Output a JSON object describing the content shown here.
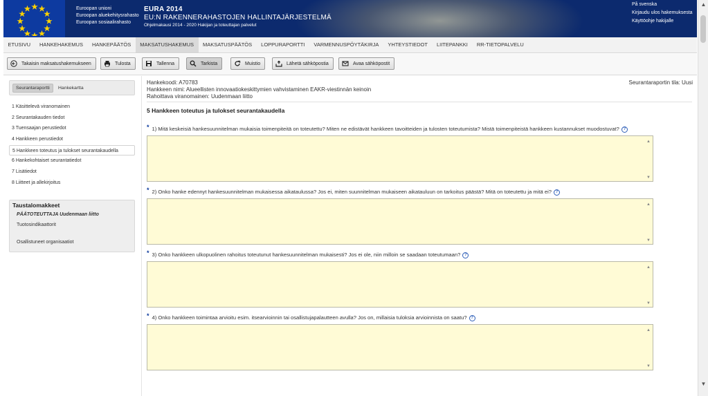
{
  "header": {
    "eu_lines": [
      "Euroopan unioni",
      "Euroopan aluekehitysrahasto",
      "Euroopan sosiaalirahasto"
    ],
    "title": "EURA 2014",
    "subtitle": "EU:N RAKENNERAHASTOJEN HALLINTAJÄRJESTELMÄ",
    "tagline": "Ohjelmakausi 2014 - 2020 Hakijan ja toteuttajan palvelut",
    "links": [
      "På svenska",
      "Kirjaudu ulos hakemuksesta",
      "Käyttöohje hakijalle"
    ]
  },
  "nav": {
    "items": [
      "ETUSIVU",
      "HANKEHAKEMUS",
      "HANKEPÄÄTÖS",
      "MAKSATUSHAKEMUS",
      "MAKSATUSPÄÄTÖS",
      "LOPPURAPORTTI",
      "VARMENNUSPÖYTÄKIRJA",
      "YHTEYSTIEDOT",
      "LIITEPANKKI",
      "RR-TIETOPALVELU"
    ],
    "active_index": 3
  },
  "toolbar": {
    "back": "Takaisin maksatushakemukseen",
    "print": "Tulosta",
    "save": "Tallenna",
    "check": "Tarkista",
    "memo": "Muistio",
    "send": "Lähetä sähköpostia",
    "open_mail": "Avaa sähköpostit"
  },
  "sidebar": {
    "tabs": [
      "Seurantaraportti",
      "Hankekartta"
    ],
    "items": [
      "1 Käsittelevä viranomainen",
      "2 Seurantakauden tiedot",
      "3 Tuensaajan perustiedot",
      "4 Hankkeen perustiedot",
      "5 Hankkeen toteutus ja tulokset seurantakaudella",
      "6 Hankekohtaiset seurantatiedot",
      "7 Lisätiedot",
      "8 Liitteet ja allekirjoitus"
    ],
    "active_index": 4,
    "background": {
      "title": "Taustalomakkeet",
      "items": [
        "PÄÄTOTEUTTAJA Uudenmaan liitto",
        "Tuotosindikaattorit",
        "Osallistuneet organisaatiot"
      ]
    }
  },
  "content": {
    "project_code": "Hankekoodi: A70783",
    "project_name": "Hankkeen nimi: Alueellisten innovaatiokeskittymien vahvistaminen EAKR-viestinnän keinoin",
    "authority": "Rahoittava viranomainen: Uudenmaan liitto",
    "report_status": "Seurantaraportin tila: Uusi",
    "section_title": "5 Hankkeen toteutus ja tulokset seurantakaudella",
    "required_mark": "*",
    "help_glyph": "?",
    "questions": [
      {
        "text": "1) Mitä keskeisiä hankesuunnitelman mukaisia toimenpiteitä on toteutettu? Miten ne edistävät hankkeen tavoitteiden ja tulosten toteutumista? Mistä toimenpiteistä hankkeen kustannukset muodostuvat?",
        "value": ""
      },
      {
        "text": "2) Onko hanke edennyt hankesuunnitelman mukaisessa aikataulussa? Jos ei, miten suunnitelman mukaiseen aikatauluun on tarkoitus päästä? Mitä on toteutettu ja mitä ei?",
        "value": ""
      },
      {
        "text": "3) Onko hankkeen ulkopuolinen rahoitus toteutunut hankesuunnitelman mukaisesti? Jos ei ole, niin milloin se saadaan toteutumaan?",
        "value": ""
      },
      {
        "text": "4) Onko hankkeen toimintaa arvioitu esim. itsearvioinnin tai osallistujapalautteen avulla? Jos on, millaisia tuloksia arvioinnista on saatu?",
        "value": ""
      }
    ]
  },
  "colors": {
    "header_bg": "#0c2a6e",
    "textarea_bg": "#fffbd6",
    "required": "#0c3a9c"
  }
}
